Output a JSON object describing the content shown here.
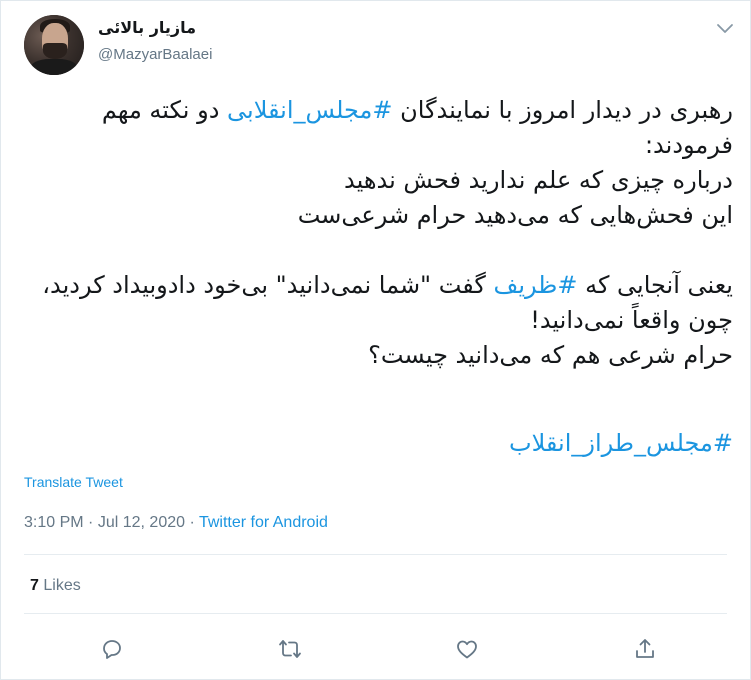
{
  "author": {
    "name": "مازیار بالائی",
    "handle": "@MazyarBaalaei"
  },
  "tweet": {
    "p1_a": "رهبری در دیدار امروز با نمایندگان ",
    "p1_hashtag": "#مجلس_انقلابی",
    "p1_b": " دو نکته مهم فرمودند:\nدرباره چیزی که علم ندارید فحش ندهید\nاین فحش‌هایی که می‌دهید حرام شرعی‌ست\n\nیعنی آنجایی که ",
    "p2_hashtag": "#ظریف",
    "p2_b": " گفت \"شما نمی‌دانید\" بی‌خود دادوبیداد کردید، چون واقعاً نمی‌دانید!\nحرام شرعی هم که می‌دانید چیست؟",
    "final_hashtag": "#مجلس_طراز_انقلاب"
  },
  "translate_label": "Translate Tweet",
  "meta": {
    "time": "3:10 PM",
    "date": "Jul 12, 2020",
    "dot": "·",
    "source": "Twitter for Android"
  },
  "likes": {
    "count": "7",
    "label": "Likes"
  },
  "icons": {
    "caret": "chevron-down-icon",
    "reply": "reply-icon",
    "retweet": "retweet-icon",
    "like": "heart-icon",
    "share": "share-icon"
  },
  "colors": {
    "link": "#1b95e0",
    "secondary": "#657786",
    "text": "#14171a",
    "border": "#e6ecf0"
  }
}
